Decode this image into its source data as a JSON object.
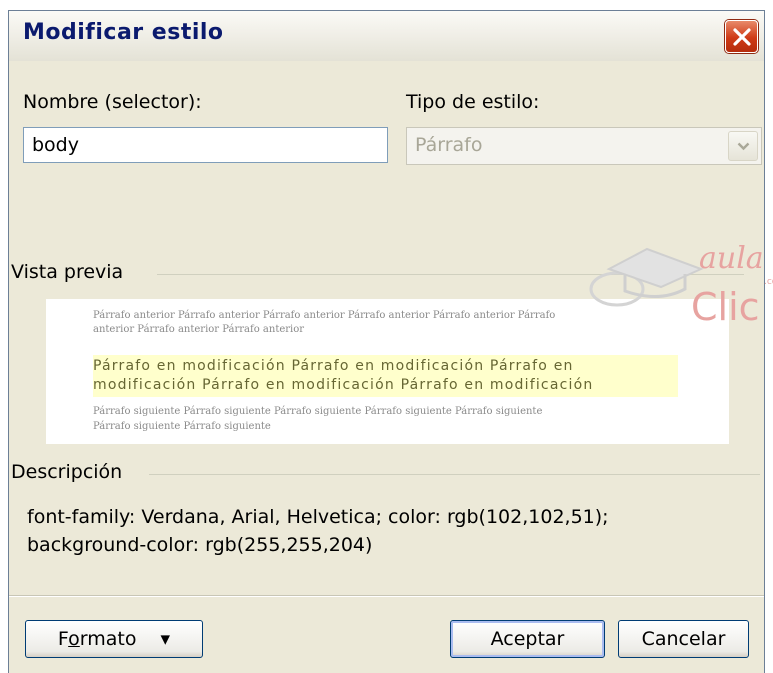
{
  "window": {
    "title": "Modificar estilo"
  },
  "name_field": {
    "label": "Nombre (selector):",
    "value": "body"
  },
  "style_type": {
    "label": "Tipo de estilo:",
    "selected": "Párrafo"
  },
  "preview": {
    "label": "Vista previa",
    "previous_line1": "Párrafo anterior Párrafo anterior Párrafo anterior Párrafo anterior Párrafo anterior Párrafo",
    "previous_line2": "anterior Párrafo anterior Párrafo anterior",
    "modified_line1": "Párrafo en modificación Párrafo en modificación Párrafo en",
    "modified_line2": "modificación Párrafo en modificación Párrafo en modificación",
    "next_line1": "Párrafo siguiente Párrafo siguiente Párrafo siguiente Párrafo siguiente Párrafo siguiente",
    "next_line2": "Párrafo siguiente Párrafo siguiente"
  },
  "description": {
    "label": "Descripción",
    "line1": "font-family: Verdana, Arial, Helvetica; color: rgb(102,102,51);",
    "line2": "background-color: rgb(255,255,204)"
  },
  "buttons": {
    "format_prefix": "F",
    "format_underlined": "o",
    "format_suffix": "rmato",
    "format_arrow": "▾",
    "ok": "Aceptar",
    "cancel": "Cancelar"
  },
  "watermark": {
    "text_top": "aula",
    "text_bottom": "Clic",
    "text_small": ".com"
  },
  "icons": {
    "close": "close-icon",
    "dropdown": "chevron-down-icon",
    "watermark": "graduation-cap-icon"
  },
  "colors": {
    "close_button": "#cf3a16",
    "title_text": "#0b1a6e",
    "modified_paragraph_text": "#666633",
    "modified_paragraph_background": "#ffffcc",
    "watermark": "#e7a3a0"
  }
}
